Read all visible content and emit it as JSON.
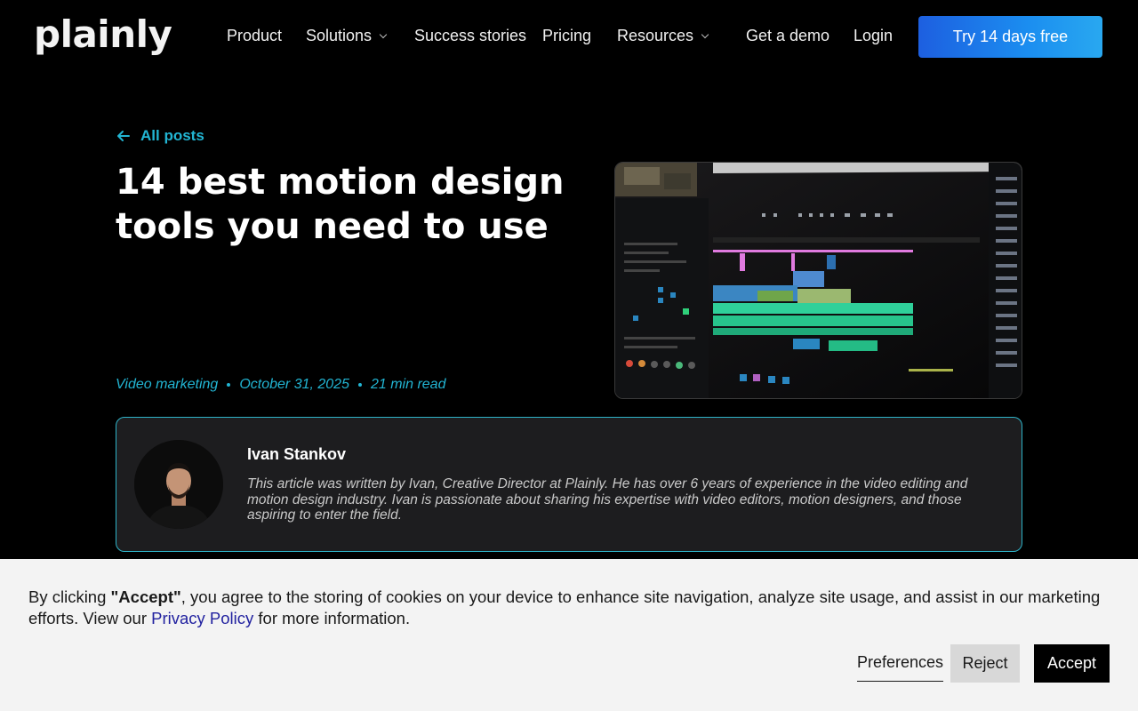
{
  "header": {
    "logo": "plainly",
    "nav": {
      "product": "Product",
      "solutions": "Solutions",
      "success_stories": "Success stories",
      "pricing": "Pricing",
      "resources": "Resources",
      "get_demo": "Get a demo",
      "login": "Login"
    },
    "cta": "Try 14 days free"
  },
  "hero": {
    "back_link": "All posts",
    "title": "14 best motion design tools you need to use",
    "meta": {
      "category": "Video marketing",
      "date": "October 31, 2025",
      "read_time": "21 min read"
    }
  },
  "author": {
    "name": "Ivan Stankov",
    "bio": "This article was written by Ivan, Creative Director at Plainly. He has over 6 years of experience in the video editing and motion design industry. Ivan is passionate about sharing his expertise with video editors, motion designers, and those aspiring to enter the field."
  },
  "cookie": {
    "text_before_bold": "By clicking ",
    "bold": "\"Accept\"",
    "text_after_bold": ", you agree to the storing of cookies on your device to enhance site navigation, analyze site usage, and assist in our marketing efforts. View our ",
    "link": "Privacy Policy",
    "text_end": " for more information.",
    "preferences": "Preferences",
    "reject": "Reject",
    "accept": "Accept"
  },
  "colors": {
    "accent": "#22b5d3",
    "cta_gradient_start": "#1d5fe0",
    "cta_gradient_end": "#29a8f0",
    "card_bg": "#1d1d1f"
  }
}
